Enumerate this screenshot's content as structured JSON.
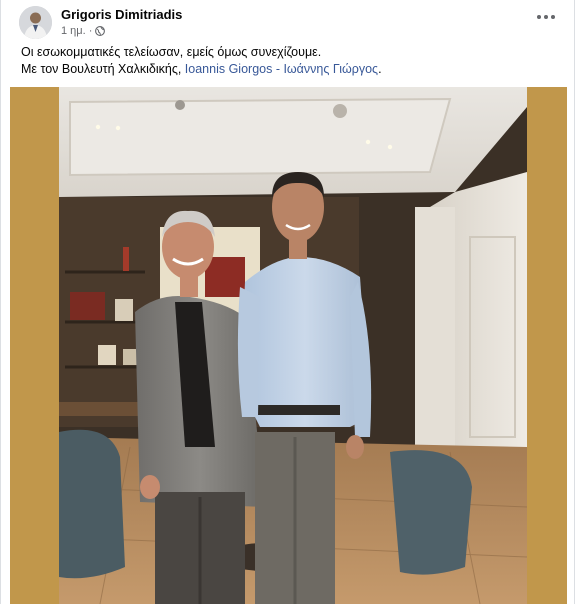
{
  "post": {
    "author": "Grigoris Dimitriadis",
    "time": "1 ημ.",
    "separator": "·",
    "privacy_icon": "globe-icon",
    "more_icon": "more-options-icon",
    "line1": "Οι εσωκομματικές τελείωσαν, εμείς όμως συνεχίζουμε.",
    "line2_prefix": "Με τον Βουλευτή Χαλκιδικής, ",
    "mention": "Ioannis Giorgos - Ιωάννης Γιώργος",
    "line2_suffix": "."
  },
  "colors": {
    "mention": "#385898",
    "photo_border": "#c1974b",
    "meta_text": "#65676b"
  }
}
